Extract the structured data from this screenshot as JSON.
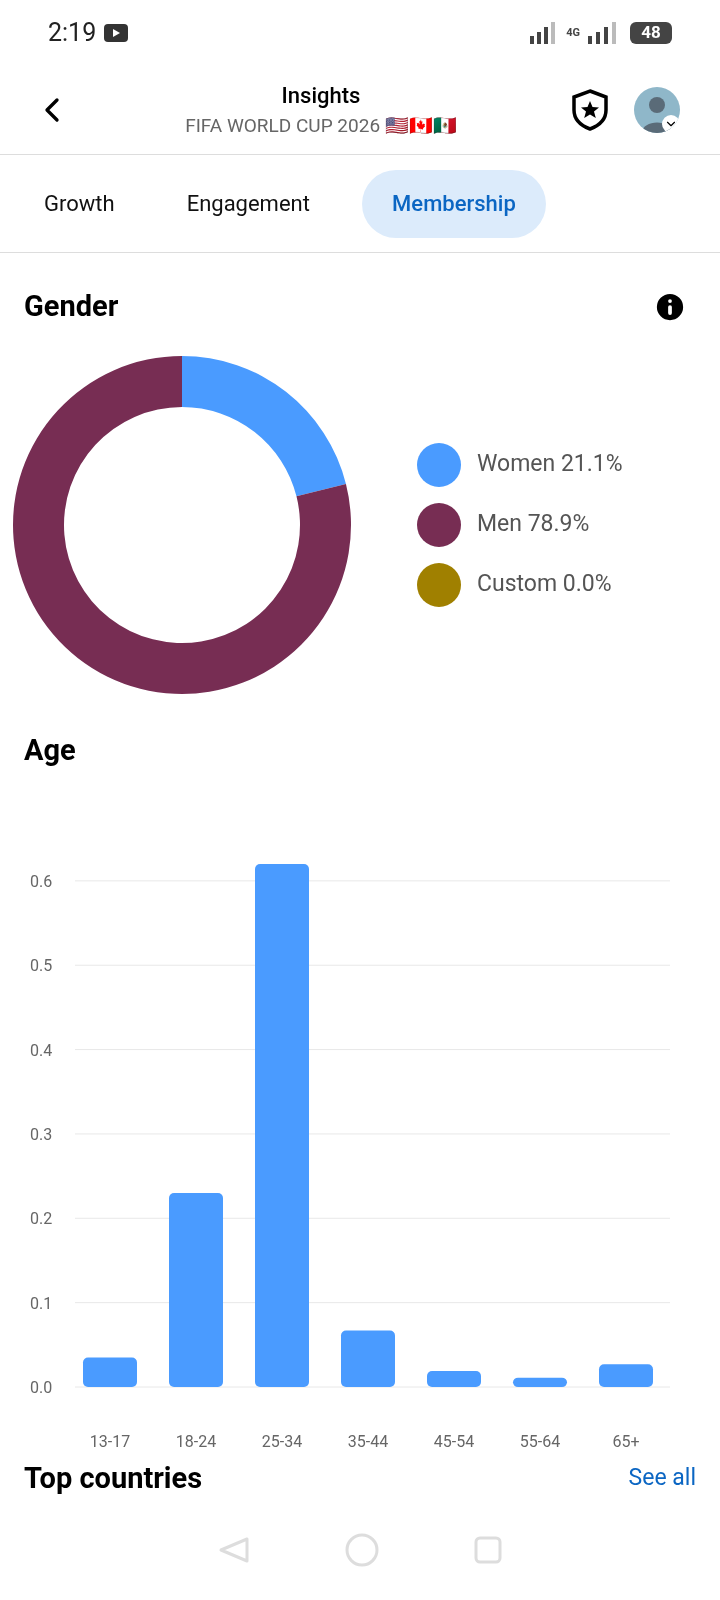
{
  "status_bar": {
    "time": "2:19",
    "network": "4G",
    "battery": "48"
  },
  "header": {
    "title": "Insights",
    "subtitle": "FIFA WORLD CUP 2026 🇺🇸🇨🇦🇲🇽"
  },
  "tabs": [
    {
      "label": "Growth",
      "selected": false
    },
    {
      "label": "Engagement",
      "selected": false
    },
    {
      "label": "Membership",
      "selected": true
    }
  ],
  "gender": {
    "title": "Gender",
    "legend": [
      {
        "label": "Women 21.1%",
        "color": "#4a9bff"
      },
      {
        "label": "Men 78.9%",
        "color": "#772d53"
      },
      {
        "label": "Custom 0.0%",
        "color": "#a08000"
      }
    ],
    "chart_data": {
      "type": "donut",
      "values": [
        21.1,
        78.9,
        0.0
      ]
    }
  },
  "age": {
    "title": "Age",
    "chart_data": {
      "type": "bar",
      "categories": [
        "13-17",
        "18-24",
        "25-34",
        "35-44",
        "45-54",
        "55-64",
        "65+"
      ],
      "series": [
        {
          "color": "#4a9bff",
          "values": [
            0.035,
            0.23,
            0.62,
            0.067,
            0.019,
            0.011,
            0.027
          ]
        }
      ],
      "ylim": [
        0,
        0.62
      ],
      "grid": true,
      "yticks": [
        {
          "value": 0,
          "label": "0.0"
        },
        {
          "value": 0.1,
          "label": "0.1"
        },
        {
          "value": 0.2,
          "label": "0.2"
        },
        {
          "value": 0.3,
          "label": "0.3"
        },
        {
          "value": 0.4,
          "label": "0.4"
        },
        {
          "value": 0.5,
          "label": "0.5"
        },
        {
          "value": 0.6,
          "label": "0.6"
        }
      ]
    }
  },
  "countries": {
    "title": "Top countries",
    "link": "See all"
  }
}
